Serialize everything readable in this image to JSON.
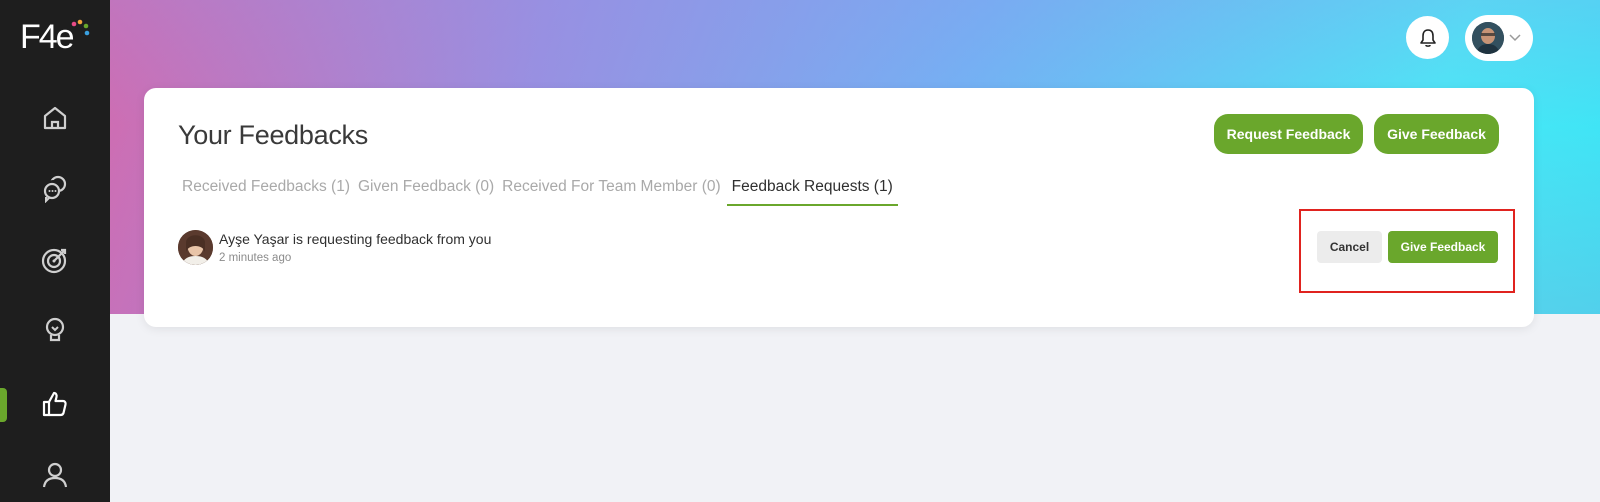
{
  "app": {
    "logo_text": "F4e",
    "accent_color": "#6aa72c"
  },
  "sidebar": {
    "items": [
      {
        "name": "home",
        "icon": "home-icon",
        "active": false
      },
      {
        "name": "conversations",
        "icon": "chat-bubbles-icon",
        "active": false
      },
      {
        "name": "goals",
        "icon": "target-icon",
        "active": false
      },
      {
        "name": "ideas",
        "icon": "lightbulb-icon",
        "active": false
      },
      {
        "name": "feedback",
        "icon": "thumbs-up-icon",
        "active": true
      },
      {
        "name": "people",
        "icon": "user-icon",
        "active": false
      }
    ]
  },
  "header": {
    "notifications_icon": "bell-icon",
    "profile_icon": "avatar",
    "profile_menu_icon": "chevron-down-icon"
  },
  "main": {
    "title": "Your Feedbacks",
    "request_button": "Request Feedback",
    "give_button": "Give Feedback",
    "tabs": [
      {
        "label": "Received Feedbacks (1)",
        "active": false
      },
      {
        "label": "Given Feedback (0)",
        "active": false
      },
      {
        "label": "Received For Team Member (0)",
        "active": false
      },
      {
        "label": "Feedback Requests (1)",
        "active": true
      }
    ],
    "requests": [
      {
        "message": "Ayşe Yaşar is requesting feedback from you",
        "time": "2 minutes ago",
        "cancel_label": "Cancel",
        "give_label": "Give Feedback"
      }
    ]
  }
}
